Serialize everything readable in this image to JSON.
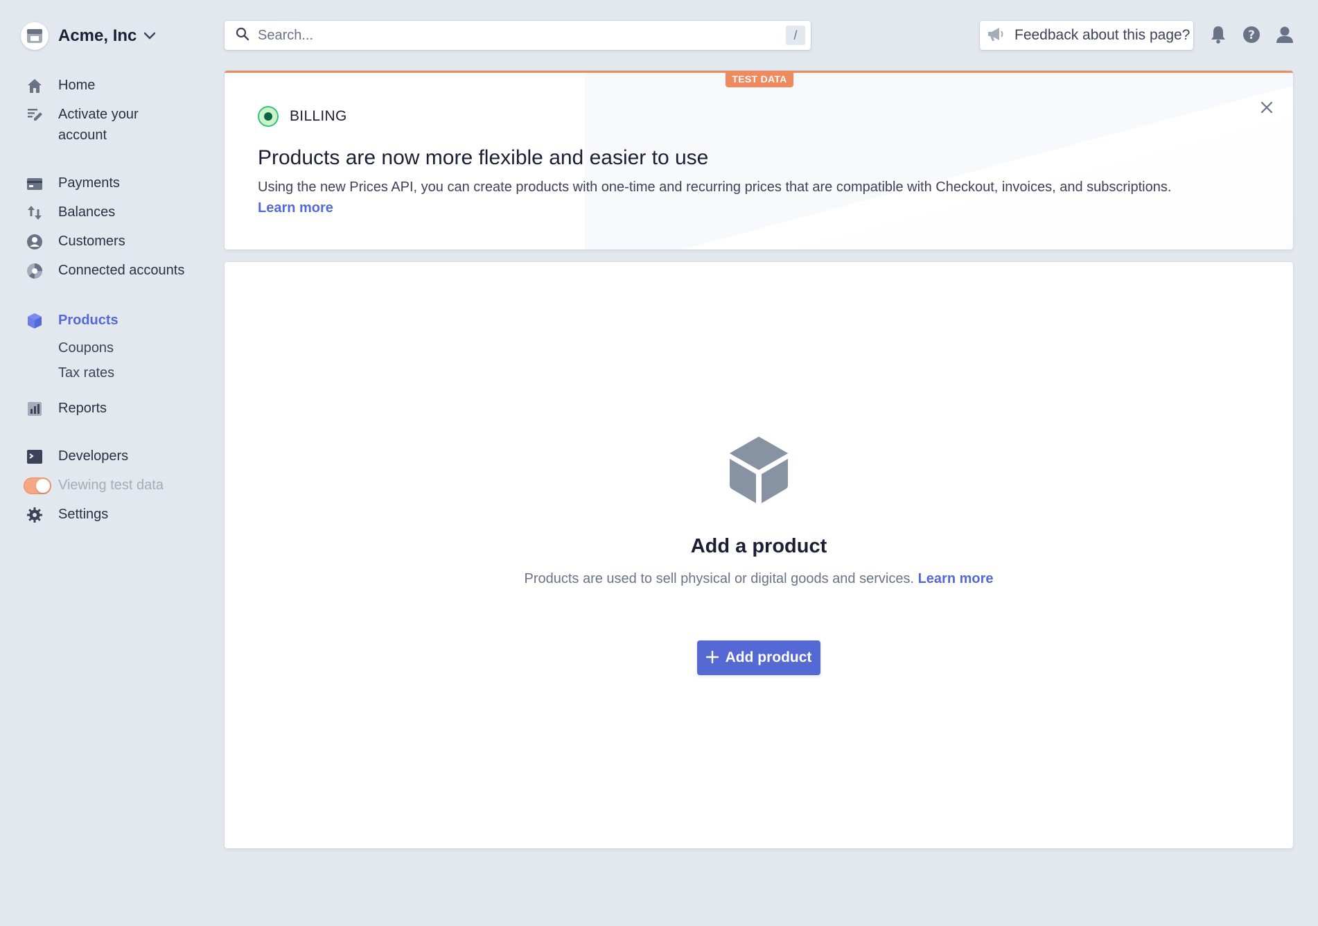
{
  "account": {
    "name": "Acme, Inc",
    "avatar_icon": "store-icon",
    "chevron_icon": "chevron-down-icon"
  },
  "sidebar": {
    "items": [
      {
        "label": "Home",
        "icon": "home-icon"
      },
      {
        "label": "Activate your account",
        "icon": "activate-icon"
      },
      {
        "label": "Payments",
        "icon": "payments-icon"
      },
      {
        "label": "Balances",
        "icon": "balances-icon"
      },
      {
        "label": "Customers",
        "icon": "customers-icon"
      },
      {
        "label": "Connected accounts",
        "icon": "connected-accounts-icon"
      },
      {
        "label": "Products",
        "icon": "product-box-icon",
        "active": true
      },
      {
        "label": "Reports",
        "icon": "reports-icon"
      },
      {
        "label": "Developers",
        "icon": "terminal-icon"
      },
      {
        "label": "Viewing test data",
        "icon": "toggle"
      },
      {
        "label": "Settings",
        "icon": "gear-icon"
      }
    ],
    "sub_items": [
      "Coupons",
      "Tax rates"
    ]
  },
  "search": {
    "placeholder": "Search...",
    "shortcut": "/"
  },
  "topbar": {
    "feedback_label": "Feedback about this page?"
  },
  "banner": {
    "badge": "TEST DATA",
    "category": "BILLING",
    "title": "Products are now more flexible and easier to use",
    "text": "Using the new Prices API, you can create products with one-time and recurring prices that are compatible with Checkout, invoices, and subscriptions.",
    "link": "Learn more"
  },
  "empty_state": {
    "title": "Add a product",
    "text": "Products are used to sell physical or digital goods and services.",
    "link": "Learn more",
    "button_label": "Add product"
  },
  "colors": {
    "accent": "#5469d4",
    "test_data": "#ee8a5e",
    "background": "#e3e8ee"
  }
}
